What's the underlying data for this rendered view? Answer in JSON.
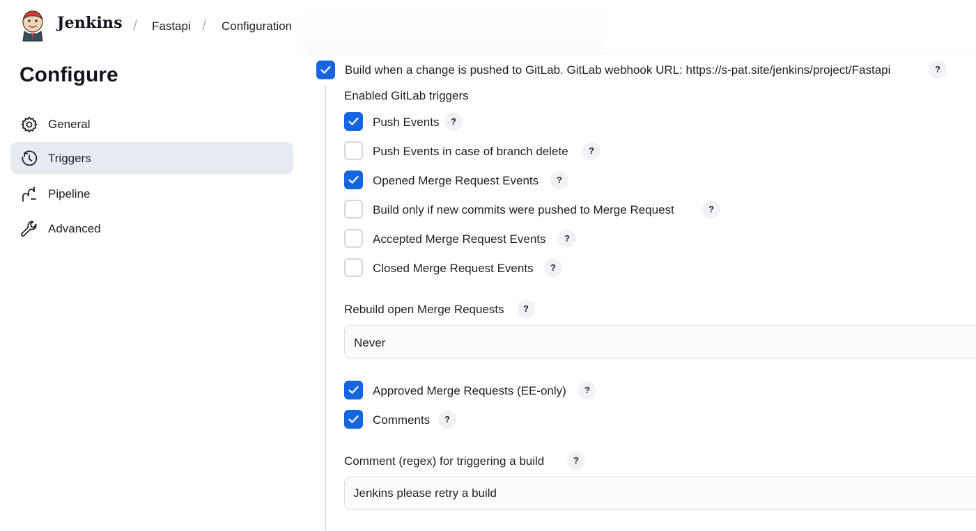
{
  "header": {
    "brand": "Jenkins",
    "breadcrumb": [
      "Fastapi",
      "Configuration"
    ],
    "separator": "/"
  },
  "sidebar": {
    "title": "Configure",
    "items": [
      {
        "label": "General",
        "icon": "gear-icon",
        "active": false
      },
      {
        "label": "Triggers",
        "icon": "clock-icon",
        "active": true
      },
      {
        "label": "Pipeline",
        "icon": "pipeline-icon",
        "active": false
      },
      {
        "label": "Advanced",
        "icon": "wrench-icon",
        "active": false
      }
    ]
  },
  "main": {
    "gitlab_trigger": {
      "label": "Build when a change is pushed to GitLab. GitLab webhook URL: https://s-pat.site/jenkins/project/Fastapi",
      "checked": true
    },
    "enabled_triggers_label": "Enabled GitLab triggers",
    "triggers": [
      {
        "label": "Push Events",
        "checked": true
      },
      {
        "label": "Push Events in case of branch delete",
        "checked": false
      },
      {
        "label": "Opened Merge Request Events",
        "checked": true
      },
      {
        "label": "Build only if new commits were pushed to Merge Request",
        "checked": false
      },
      {
        "label": "Accepted Merge Request Events",
        "checked": false
      },
      {
        "label": "Closed Merge Request Events",
        "checked": false
      }
    ],
    "rebuild": {
      "label": "Rebuild open Merge Requests",
      "selected": "Never"
    },
    "extra_triggers": [
      {
        "label": "Approved Merge Requests (EE-only)",
        "checked": true
      },
      {
        "label": "Comments",
        "checked": true
      }
    ],
    "comment_regex": {
      "label": "Comment (regex) for triggering a build",
      "value": "Jenkins please retry a build"
    },
    "help_glyph": "?"
  },
  "colors": {
    "accent": "#1565e0",
    "active_nav_bg": "#e8eaf2"
  }
}
